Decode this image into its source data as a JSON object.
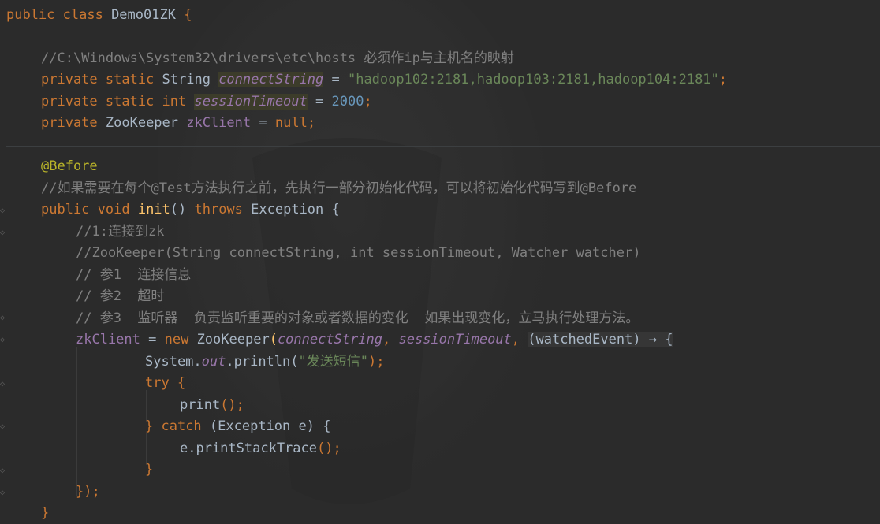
{
  "editor": {
    "lines": {
      "l1": {
        "kw": "public class ",
        "name": "Demo01ZK",
        "rest": " {"
      },
      "l3": {
        "comment": "//C:\\Windows\\System32\\drivers\\etc\\hosts 必须作ip与主机名的映射"
      },
      "l4": {
        "kw": "private static ",
        "type": "String ",
        "field": "connectString",
        "eq": " = ",
        "str": "\"hadoop102:2181,hadoop103:2181,hadoop104:2181\"",
        "end": ";"
      },
      "l5": {
        "kw": "private static int ",
        "field": "sessionTimeout",
        "eq": " = ",
        "num": "2000",
        "end": ";"
      },
      "l6": {
        "kw": "private ",
        "type": "ZooKeeper ",
        "field": "zkClient",
        "eq": " = ",
        "kw2": "null",
        "end": ";"
      },
      "l8": {
        "annotation": "@Before"
      },
      "l9": {
        "comment": "//如果需要在每个@Test方法执行之前，先执行一部分初始化代码，可以将初始化代码写到@Before"
      },
      "l10": {
        "kw": "public void ",
        "method": "init",
        "paren": "() ",
        "kw2": "throws ",
        "type": "Exception ",
        "end": "{"
      },
      "l11": {
        "comment": "//1:连接到zk"
      },
      "l12": {
        "comment": "//ZooKeeper(String connectString, int sessionTimeout, Watcher watcher)"
      },
      "l13": {
        "comment": "// 参1  连接信息"
      },
      "l14": {
        "comment": "// 参2  超时"
      },
      "l15": {
        "comment": "// 参3  监听器  负责监听重要的对象或者数据的变化  如果出现变化，立马执行处理方法。"
      },
      "l16": {
        "field": "zkClient",
        "eq": " = ",
        "kw": "new ",
        "type": "ZooKeeper",
        "open": "(",
        "arg1": "connectString",
        "comma1": ", ",
        "arg2": "sessionTimeout",
        "comma2": ", ",
        "lambda": "(watchedEvent) → {"
      },
      "l17": {
        "cls": "System.",
        "static": "out",
        "call": ".println(",
        "str": "\"发送短信\"",
        "end": ");"
      },
      "l18": {
        "kw": "try ",
        "end": "{"
      },
      "l19": {
        "call": "print",
        "end": "();"
      },
      "l20": {
        "close": "} ",
        "kw": "catch ",
        "open": "(",
        "type": "Exception e",
        "end": ") {"
      },
      "l21": {
        "call": "e.printStackTrace",
        "end": "();"
      },
      "l22": {
        "close": "}"
      },
      "l23": {
        "close": "});"
      },
      "l24": {
        "close": "}"
      }
    }
  },
  "colors": {
    "background": "#2b2b2b",
    "keyword": "#cc7832",
    "field": "#9876aa",
    "string": "#6a8759",
    "number": "#6897bb",
    "comment": "#808080",
    "annotation": "#bbb529",
    "method": "#ffc66d",
    "text": "#a9b7c6"
  }
}
